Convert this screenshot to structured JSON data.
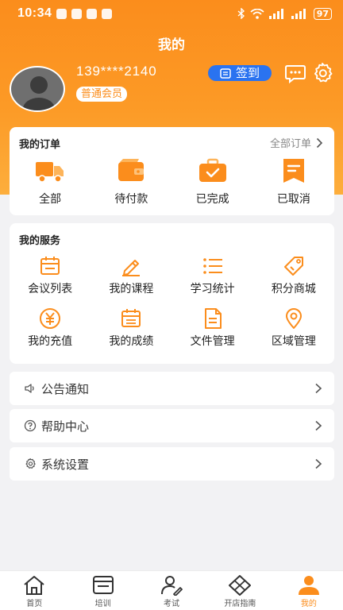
{
  "status_bar": {
    "time": "10:34",
    "battery": "97"
  },
  "header": {
    "title": "我的",
    "phone": "139****2140",
    "member_level": "普通会员",
    "signin_label": "签到"
  },
  "orders": {
    "title": "我的订单",
    "all_label": "全部订单",
    "items": [
      {
        "label": "全部",
        "icon": "truck-icon"
      },
      {
        "label": "待付款",
        "icon": "wallet-icon"
      },
      {
        "label": "已完成",
        "icon": "briefcase-check-icon"
      },
      {
        "label": "已取消",
        "icon": "bookmark-doc-icon"
      }
    ]
  },
  "services": {
    "title": "我的服务",
    "items": [
      {
        "label": "会议列表",
        "icon": "calendar-icon"
      },
      {
        "label": "我的课程",
        "icon": "pencil-icon"
      },
      {
        "label": "学习统计",
        "icon": "list-icon"
      },
      {
        "label": "积分商城",
        "icon": "tag-icon"
      },
      {
        "label": "我的充值",
        "icon": "yen-icon"
      },
      {
        "label": "我的成绩",
        "icon": "calendar-grid-icon"
      },
      {
        "label": "文件管理",
        "icon": "document-icon"
      },
      {
        "label": "区域管理",
        "icon": "location-icon"
      }
    ]
  },
  "menu": [
    {
      "label": "公告通知",
      "icon": "speaker-icon"
    },
    {
      "label": "帮助中心",
      "icon": "help-icon"
    },
    {
      "label": "系统设置",
      "icon": "gear-icon"
    }
  ],
  "tabs": [
    {
      "label": "首页",
      "icon": "home-icon",
      "active": false
    },
    {
      "label": "培训",
      "icon": "board-icon",
      "active": false
    },
    {
      "label": "考试",
      "icon": "user-pen-icon",
      "active": false
    },
    {
      "label": "开店指南",
      "icon": "diamond-grid-icon",
      "active": false
    },
    {
      "label": "我的",
      "icon": "person-icon",
      "active": true
    }
  ],
  "colors": {
    "accent": "#fb8d1c",
    "signin": "#2a73f0",
    "background": "#f2f2f4"
  }
}
